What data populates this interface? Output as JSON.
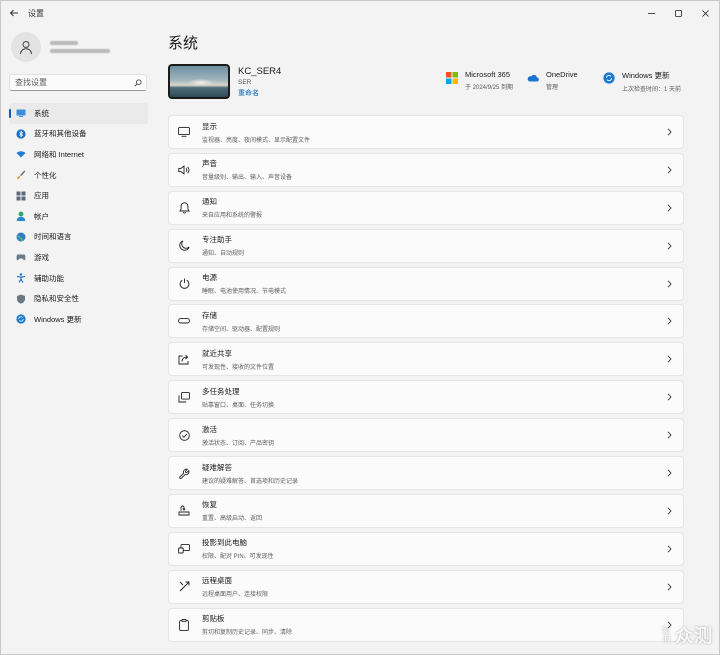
{
  "window": {
    "title": "设置"
  },
  "sidebar": {
    "search_placeholder": "查找设置",
    "items": [
      {
        "label": "系统",
        "icon": "monitor-icon",
        "active": true
      },
      {
        "label": "蓝牙和其他设备",
        "icon": "bluetooth-icon"
      },
      {
        "label": "网络和 Internet",
        "icon": "wifi-icon"
      },
      {
        "label": "个性化",
        "icon": "brush-icon"
      },
      {
        "label": "应用",
        "icon": "apps-icon"
      },
      {
        "label": "帐户",
        "icon": "person-icon"
      },
      {
        "label": "时间和语言",
        "icon": "globe-clock-icon"
      },
      {
        "label": "游戏",
        "icon": "gamepad-icon"
      },
      {
        "label": "辅助功能",
        "icon": "accessibility-icon"
      },
      {
        "label": "隐私和安全性",
        "icon": "shield-icon"
      },
      {
        "label": "Windows 更新",
        "icon": "update-icon"
      }
    ]
  },
  "main": {
    "title": "系统",
    "device": {
      "name": "KC_SER4",
      "model": "SER",
      "rename": "重命名"
    },
    "quick": [
      {
        "title": "Microsoft 365",
        "sub": "于 2024/9/25 到期",
        "icon": "microsoft-logo-icon"
      },
      {
        "title": "OneDrive",
        "sub": "管理",
        "icon": "cloud-icon"
      },
      {
        "title": "Windows 更新",
        "sub": "上次检查时间：1 天前",
        "icon": "update-icon"
      }
    ],
    "cards": [
      {
        "title": "显示",
        "sub": "监视器、亮度、夜间模式、显示配置文件",
        "icon": "display-icon"
      },
      {
        "title": "声音",
        "sub": "音量级别、输出、输入、声音设备",
        "icon": "speaker-icon"
      },
      {
        "title": "通知",
        "sub": "来自应用和系统的警报",
        "icon": "bell-icon"
      },
      {
        "title": "专注助手",
        "sub": "通知、自动规则",
        "icon": "moon-icon"
      },
      {
        "title": "电源",
        "sub": "睡眠、电池使用情况、节电模式",
        "icon": "power-icon"
      },
      {
        "title": "存储",
        "sub": "存储空间、驱动器、配置规则",
        "icon": "storage-icon"
      },
      {
        "title": "就近共享",
        "sub": "可发现性、接收的文件位置",
        "icon": "share-icon"
      },
      {
        "title": "多任务处理",
        "sub": "贴靠窗口、桌面、任务切换",
        "icon": "multitask-icon"
      },
      {
        "title": "激活",
        "sub": "激活状态、订阅、产品密钥",
        "icon": "check-circle-icon"
      },
      {
        "title": "疑难解答",
        "sub": "建议的疑难解答、首选项和历史记录",
        "icon": "wrench-icon"
      },
      {
        "title": "恢复",
        "sub": "重置、高级启动、返回",
        "icon": "recovery-icon"
      },
      {
        "title": "投影到此电脑",
        "sub": "权限、配对 PIN、可发现性",
        "icon": "project-icon"
      },
      {
        "title": "远程桌面",
        "sub": "远程桌面用户、连接权限",
        "icon": "remote-icon"
      },
      {
        "title": "剪贴板",
        "sub": "剪切和复制历史记录、同步、清除",
        "icon": "clipboard-icon"
      }
    ]
  },
  "watermark": {
    "small": "新浪",
    "big": "众测"
  },
  "colors": {
    "accent": "#005fb8",
    "background": "#f3f3f3",
    "card": "#fbfbfb"
  }
}
